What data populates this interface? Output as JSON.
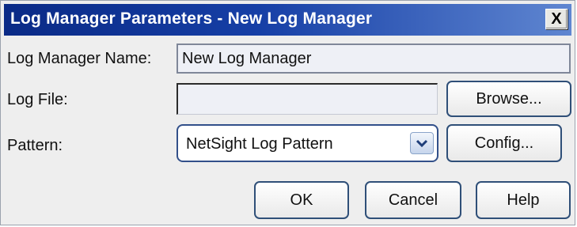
{
  "dialog": {
    "title": "Log Manager Parameters - New Log Manager",
    "close_label": "X"
  },
  "fields": {
    "name_label": "Log Manager Name:",
    "name_value": "New Log Manager",
    "log_file_label": "Log File:",
    "log_file_value": "",
    "pattern_label": "Pattern:",
    "pattern_value": "NetSight Log Pattern"
  },
  "buttons": {
    "browse": "Browse...",
    "config": "Config...",
    "ok": "OK",
    "cancel": "Cancel",
    "help": "Help"
  },
  "icons": {
    "close": "close-icon",
    "dropdown": "chevron-down-icon"
  }
}
